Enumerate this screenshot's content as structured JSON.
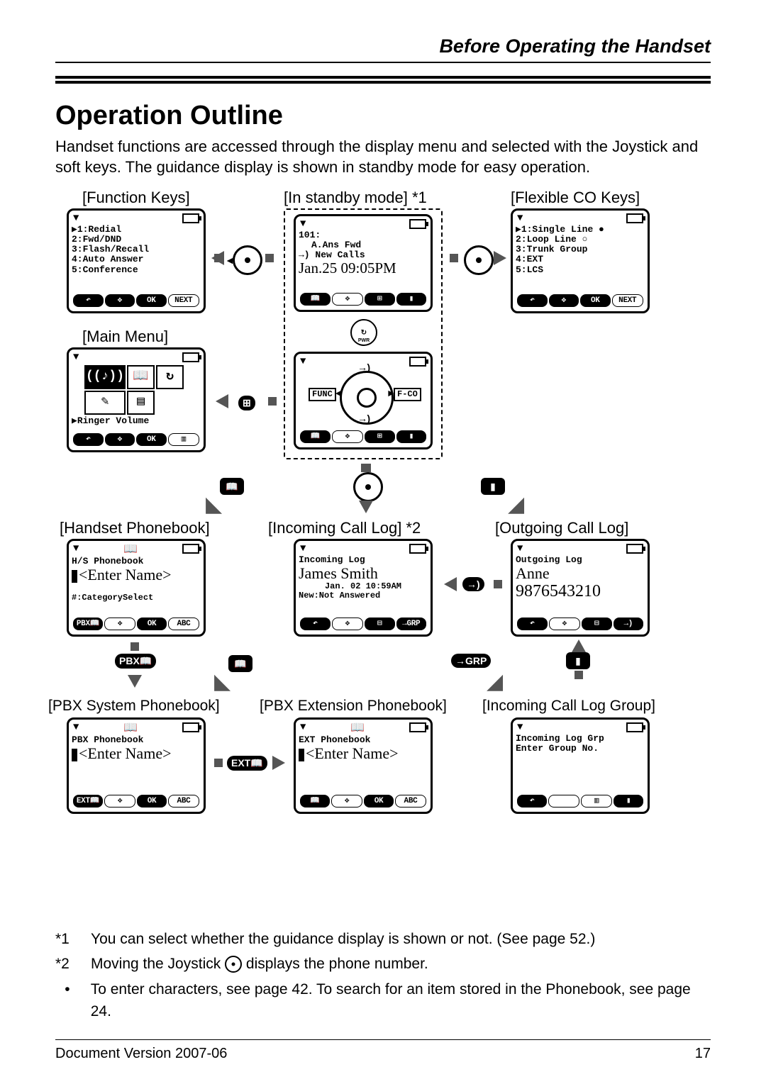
{
  "header": {
    "section": "Before Operating the Handset"
  },
  "title": "Operation Outline",
  "intro": "Handset functions are accessed through the display menu and selected with the Joystick and soft keys. The guidance display is shown in standby mode for easy operation.",
  "captions": {
    "function_keys": "[Function Keys]",
    "standby": "[In standby mode] *1",
    "flexible_co": "[Flexible CO Keys]",
    "main_menu": "[Main Menu]",
    "handset_pb": "[Handset Phonebook]",
    "incoming_log": "[Incoming Call Log] *2",
    "outgoing_log": "[Outgoing Call Log]",
    "pbx_sys_pb": "[PBX System Phonebook]",
    "pbx_ext_pb": "[PBX Extension Phonebook]",
    "incoming_grp": "[Incoming Call Log Group]"
  },
  "screens": {
    "function_keys": {
      "lines": [
        "▶1:Redial",
        " 2:Fwd/DND",
        " 3:Flash/Recall",
        " 4:Auto Answer",
        " 5:Conference"
      ],
      "soft": [
        "↶",
        "✥",
        "OK",
        "NEXT"
      ]
    },
    "standby": {
      "ext": "101:",
      "l2": "A.Ans Fwd",
      "l3": "→) New Calls",
      "datetime": "Jan.25 09:05PM",
      "soft": [
        "📖",
        "✥",
        "⊞",
        "▮"
      ]
    },
    "flexible_co": {
      "lines": [
        "▶1:Single Line ●",
        " 2:Loop Line   ○",
        " 3:Trunk Group",
        " 4:EXT",
        " 5:LCS"
      ],
      "soft": [
        "↶",
        "✥",
        "OK",
        "NEXT"
      ]
    },
    "main_menu": {
      "label": "▶Ringer Volume",
      "soft": [
        "↶",
        "✥",
        "OK",
        "▥"
      ]
    },
    "handset_pb": {
      "title": "H/S Phonebook",
      "entry": "<Enter Name>",
      "hint": "#:CategorySelect",
      "soft": [
        "PBX📖",
        "✥",
        "OK",
        "ABC"
      ]
    },
    "incoming_log": {
      "title": "Incoming Log",
      "name": "James Smith",
      "ts": "Jan. 02 10:59AM",
      "status": "New:Not Answered",
      "soft": [
        "↶",
        "✥",
        "⊟",
        "→GRP"
      ]
    },
    "outgoing_log": {
      "title": "Outgoing Log",
      "name": "Anne",
      "number": "9876543210",
      "soft": [
        "↶",
        "✥",
        "⊟",
        "→)"
      ]
    },
    "pbx_sys_pb": {
      "title": "PBX Phonebook",
      "entry": "<Enter Name>",
      "soft": [
        "EXT📖",
        "✥",
        "OK",
        "ABC"
      ]
    },
    "pbx_ext_pb": {
      "title": "EXT Phonebook",
      "entry": "<Enter Name>",
      "soft": [
        "📖",
        "✥",
        "OK",
        "ABC"
      ]
    },
    "incoming_grp": {
      "title": "Incoming Log Grp",
      "l2": "Enter Group No.",
      "soft": [
        "↶",
        "",
        "▥",
        "▮"
      ]
    }
  },
  "btn_labels": {
    "pbx_book": "PBX📖",
    "grp": "→GRP",
    "ext_book": "EXT📖",
    "func": "FUNC",
    "fco": "F-CO",
    "book": "📖",
    "redial_arrow": "→)"
  },
  "notes": {
    "n1_tag": "*1",
    "n1": "You can select whether the guidance display is shown or not. (See page 52.)",
    "n2_tag": "*2",
    "n2_a": "Moving the Joystick ",
    "n2_b": " displays the phone number.",
    "bullet": "To enter characters, see page 42. To search for an item stored in the Phonebook, see page 24."
  },
  "footer": {
    "version": "Document Version 2007-06",
    "page": "17"
  }
}
